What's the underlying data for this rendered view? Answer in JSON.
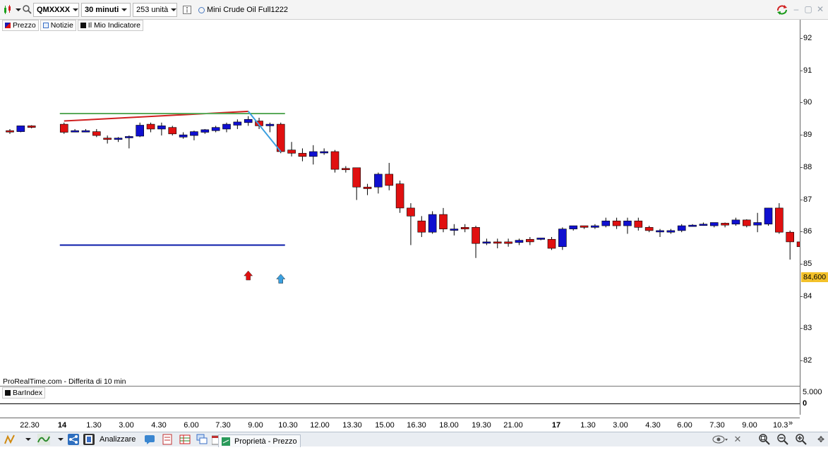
{
  "toolbar": {
    "symbol": "QMXXXX",
    "timeframe": "30 minuti",
    "units": "253 unità",
    "instrument_name": "Mini Crude Oil Full1222"
  },
  "legend": [
    {
      "label": "Prezzo",
      "color": "#1a1ab0"
    },
    {
      "label": "Notizie",
      "color": "#3a6fc7"
    },
    {
      "label": "Il Mio Indicatore",
      "color": "#111111"
    }
  ],
  "source_text": "ProRealTime.com - Differita di 10 min",
  "current_price_tag": "84,600",
  "indicator_panel": {
    "label": "BarIndex",
    "axis_top": "5.000",
    "axis_zero": "0"
  },
  "taskbar": {
    "analyzer_label": "Analizzare",
    "properties_label": "Proprietà - Prezzo"
  },
  "colors": {
    "bull": "#1010d0",
    "bear": "#e01010",
    "trend_red": "#d02020",
    "trend_green": "#5aaa5a",
    "support_blue": "#0a1aaa",
    "arrow_up_red": "#e01010",
    "arrow_up_blue": "#3aa0e0",
    "price_tag_bg": "#f3c12a"
  },
  "chart_data": {
    "type": "candlestick",
    "y_axis_ticks": [
      92,
      91,
      90,
      89,
      88,
      87,
      86,
      85,
      84,
      83,
      82
    ],
    "ylim": [
      81.2,
      92.5
    ],
    "x_axis_labels": [
      "22.30",
      "14",
      "1.30",
      "3.00",
      "4.30",
      "6.00",
      "7.30",
      "9.00",
      "10.30",
      "12.00",
      "13.30",
      "15.00",
      "16.30",
      "18.00",
      "19.30",
      "21.00",
      "17",
      "1.30",
      "3.00",
      "4.30",
      "6.00",
      "7.30",
      "9.00",
      "10.3"
    ],
    "x_axis_bold": [
      "14",
      "17"
    ],
    "candles": [
      [
        89.15,
        89.2,
        89.12,
        89.05
      ],
      [
        89.12,
        89.3,
        89.3,
        89.1
      ],
      [
        89.3,
        89.32,
        89.25,
        89.22
      ],
      [
        89.35,
        89.4,
        89.1,
        89.05
      ],
      [
        89.15,
        89.2,
        89.15,
        89.1
      ],
      [
        89.15,
        89.2,
        89.15,
        89.1
      ],
      [
        89.12,
        89.2,
        89.0,
        88.95
      ],
      [
        88.92,
        89.0,
        88.9,
        88.75
      ],
      [
        88.88,
        88.95,
        88.92,
        88.8
      ],
      [
        88.95,
        89.0,
        88.97,
        88.6
      ],
      [
        88.98,
        89.4,
        89.32,
        88.95
      ],
      [
        89.35,
        89.4,
        89.2,
        89.1
      ],
      [
        89.2,
        89.4,
        89.3,
        89.0
      ],
      [
        89.25,
        89.3,
        89.05,
        89.0
      ],
      [
        88.95,
        89.1,
        89.02,
        88.9
      ],
      [
        89.0,
        89.15,
        89.12,
        88.85
      ],
      [
        89.1,
        89.2,
        89.18,
        89.05
      ],
      [
        89.15,
        89.3,
        89.25,
        89.1
      ],
      [
        89.2,
        89.4,
        89.35,
        89.1
      ],
      [
        89.32,
        89.5,
        89.42,
        89.2
      ],
      [
        89.4,
        89.6,
        89.5,
        89.3
      ],
      [
        89.45,
        89.55,
        89.3,
        89.2
      ],
      [
        89.3,
        89.4,
        89.35,
        89.1
      ],
      [
        89.35,
        89.4,
        88.5,
        88.45
      ],
      [
        88.55,
        88.8,
        88.45,
        88.35
      ],
      [
        88.45,
        88.6,
        88.35,
        88.2
      ],
      [
        88.35,
        88.7,
        88.5,
        88.1
      ],
      [
        88.5,
        88.6,
        88.5,
        88.4
      ],
      [
        88.5,
        88.55,
        87.95,
        87.85
      ],
      [
        87.98,
        88.05,
        87.95,
        87.85
      ],
      [
        88.0,
        88.0,
        87.4,
        87.0
      ],
      [
        87.4,
        87.5,
        87.35,
        87.15
      ],
      [
        87.4,
        87.85,
        87.8,
        87.2
      ],
      [
        87.8,
        88.15,
        87.45,
        87.3
      ],
      [
        87.5,
        87.6,
        86.75,
        86.6
      ],
      [
        86.75,
        86.9,
        86.5,
        85.6
      ],
      [
        86.35,
        86.5,
        86.0,
        85.85
      ],
      [
        86.0,
        86.65,
        86.55,
        85.95
      ],
      [
        86.55,
        86.75,
        86.1,
        86.0
      ],
      [
        86.1,
        86.25,
        86.1,
        85.9
      ],
      [
        86.15,
        86.25,
        86.1,
        86.0
      ],
      [
        86.15,
        86.2,
        85.65,
        85.2
      ],
      [
        85.7,
        85.8,
        85.7,
        85.6
      ],
      [
        85.7,
        85.8,
        85.68,
        85.5
      ],
      [
        85.7,
        85.8,
        85.65,
        85.55
      ],
      [
        85.68,
        85.8,
        85.75,
        85.6
      ],
      [
        85.78,
        85.85,
        85.7,
        85.6
      ],
      [
        85.8,
        85.82,
        85.82,
        85.75
      ],
      [
        85.78,
        85.85,
        85.5,
        85.45
      ],
      [
        85.55,
        86.15,
        86.1,
        85.45
      ],
      [
        86.1,
        86.2,
        86.2,
        86.05
      ],
      [
        86.2,
        86.2,
        86.15,
        86.1
      ],
      [
        86.15,
        86.25,
        86.2,
        86.1
      ],
      [
        86.2,
        86.45,
        86.35,
        86.15
      ],
      [
        86.35,
        86.45,
        86.2,
        86.1
      ],
      [
        86.2,
        86.45,
        86.35,
        85.95
      ],
      [
        86.35,
        86.45,
        86.15,
        86.05
      ],
      [
        86.15,
        86.2,
        86.05,
        86.0
      ],
      [
        86.05,
        86.1,
        86.05,
        85.85
      ],
      [
        86.0,
        86.1,
        86.05,
        85.95
      ],
      [
        86.05,
        86.25,
        86.2,
        86.0
      ],
      [
        86.2,
        86.25,
        86.22,
        86.18
      ],
      [
        86.22,
        86.3,
        86.25,
        86.2
      ],
      [
        86.2,
        86.3,
        86.3,
        86.15
      ],
      [
        86.28,
        86.3,
        86.22,
        86.15
      ],
      [
        86.25,
        86.45,
        86.38,
        86.2
      ],
      [
        86.38,
        86.4,
        86.2,
        86.15
      ],
      [
        86.22,
        86.6,
        86.3,
        86.0
      ],
      [
        86.25,
        86.75,
        86.75,
        86.2
      ],
      [
        86.75,
        86.9,
        86.0,
        85.95
      ],
      [
        86.0,
        86.05,
        85.7,
        85.15
      ],
      [
        85.7,
        85.85,
        85.55,
        85.3
      ]
    ],
    "annotations": [
      {
        "kind": "trendline",
        "color": "trend_red",
        "from": [
          3,
          89.45
        ],
        "to": [
          20,
          89.75
        ]
      },
      {
        "kind": "hline",
        "color": "trend_green",
        "from": 3,
        "to": 23,
        "y": 89.68
      },
      {
        "kind": "trendline",
        "color": "arrow_up_blue",
        "from": [
          20,
          89.75
        ],
        "to": [
          23,
          88.5
        ]
      },
      {
        "kind": "hline",
        "color": "support_blue",
        "from": 3,
        "to": 23,
        "y": 85.6
      },
      {
        "kind": "arrow",
        "color": "arrow_up_red",
        "x": 20,
        "y": 84.8
      },
      {
        "kind": "arrow",
        "color": "arrow_up_blue",
        "x": 23,
        "y": 84.7
      }
    ]
  }
}
